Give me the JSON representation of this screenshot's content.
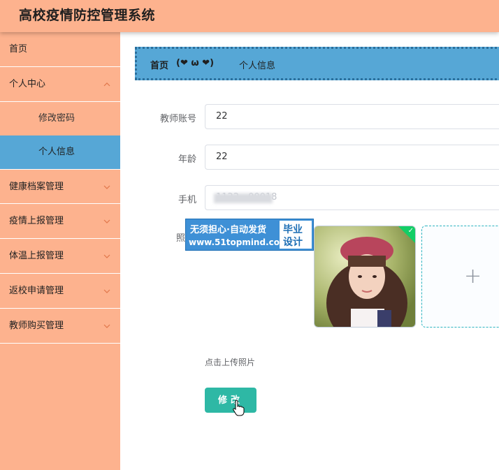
{
  "app": {
    "title": "高校疫情防控管理系统"
  },
  "sidebar": {
    "items": [
      {
        "label": "首页",
        "has_chevron": false
      },
      {
        "label": "个人中心",
        "has_chevron": true,
        "expanded": true,
        "children": [
          {
            "label": "修改密码",
            "active": false
          },
          {
            "label": "个人信息",
            "active": true
          }
        ]
      },
      {
        "label": "健康档案管理",
        "has_chevron": true
      },
      {
        "label": "疫情上报管理",
        "has_chevron": true
      },
      {
        "label": "体温上报管理",
        "has_chevron": true
      },
      {
        "label": "返校申请管理",
        "has_chevron": true
      },
      {
        "label": "教师购买管理",
        "has_chevron": true
      }
    ]
  },
  "breadcrumb": {
    "home": "首页",
    "separator": "(❤ ω ❤)",
    "current": "个人信息"
  },
  "form": {
    "account": {
      "label": "教师账号",
      "value": "22"
    },
    "age": {
      "label": "年龄",
      "value": "22"
    },
    "phone": {
      "label": "手机",
      "value": "1122…00018"
    },
    "photo": {
      "label": "照片",
      "hint": "点击上传照片"
    },
    "submit_label": "修改"
  },
  "watermark": {
    "line1": "无须担心·自动发货",
    "line2": "www.51topmind.com",
    "box_top": "毕业",
    "box_bottom": "设计"
  },
  "colors": {
    "header_bg": "#fdb28e",
    "sidebar_bg": "#fdb28e",
    "active_bg": "#56a7d6",
    "button_bg": "#2eb8a5",
    "success": "#13ce66"
  },
  "icons": {
    "chevron": "chevron-down-icon",
    "upload": "plus-icon",
    "success": "check-icon",
    "cursor": "hand-pointer-icon"
  }
}
